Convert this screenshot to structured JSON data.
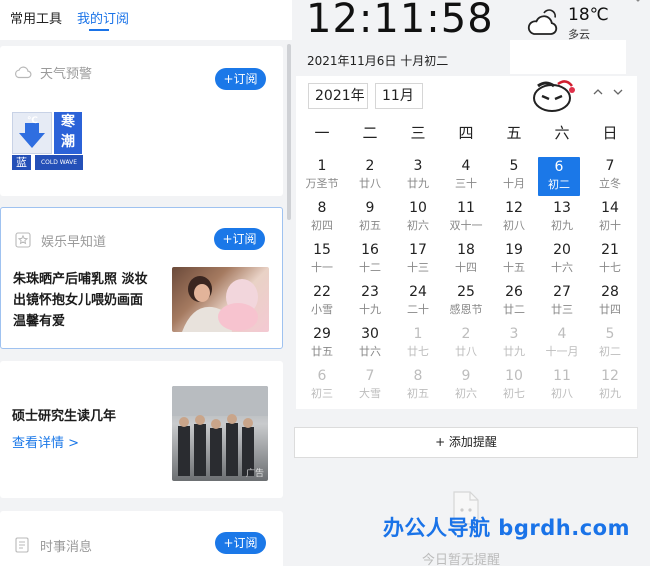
{
  "tabs": {
    "tools": "常用工具",
    "subscriptions": "我的订阅"
  },
  "subscribe_label": "+订阅",
  "cards": {
    "weather": {
      "title": "天气预警",
      "badge_blue_label": "蓝",
      "badge_temp": "℃",
      "badge_cold_top": "寒",
      "badge_cold_bottom": "潮",
      "badge_cold_en": "COLD WAVE"
    },
    "entertainment": {
      "title": "娱乐早知道",
      "headline_line1": "朱珠晒产后哺乳照 淡妆",
      "headline_line2": "出镜怀抱女儿喂奶画面",
      "headline_line3": "温馨有爱"
    },
    "ad": {
      "headline": "硕士研究生读几年",
      "more_link": "查看详情 >",
      "ad_tag": "广告"
    },
    "news": {
      "title": "时事消息"
    }
  },
  "clock": {
    "time": "12:11:58",
    "date": "2021年11月6日  十月初二"
  },
  "weather": {
    "temp": "18℃",
    "desc": "多云",
    "icon": "cloud-sun-icon"
  },
  "calendar": {
    "year": "2021年",
    "month": "11月",
    "weekdays": [
      "一",
      "二",
      "三",
      "四",
      "五",
      "六",
      "日"
    ],
    "days": [
      {
        "d": "1",
        "l": "万圣节"
      },
      {
        "d": "2",
        "l": "廿八"
      },
      {
        "d": "3",
        "l": "廿九"
      },
      {
        "d": "4",
        "l": "三十"
      },
      {
        "d": "5",
        "l": "十月"
      },
      {
        "d": "6",
        "l": "初二",
        "today": true
      },
      {
        "d": "7",
        "l": "立冬"
      },
      {
        "d": "8",
        "l": "初四"
      },
      {
        "d": "9",
        "l": "初五"
      },
      {
        "d": "10",
        "l": "初六"
      },
      {
        "d": "11",
        "l": "双十一"
      },
      {
        "d": "12",
        "l": "初八"
      },
      {
        "d": "13",
        "l": "初九"
      },
      {
        "d": "14",
        "l": "初十"
      },
      {
        "d": "15",
        "l": "十一"
      },
      {
        "d": "16",
        "l": "十二"
      },
      {
        "d": "17",
        "l": "十三"
      },
      {
        "d": "18",
        "l": "十四"
      },
      {
        "d": "19",
        "l": "十五"
      },
      {
        "d": "20",
        "l": "十六"
      },
      {
        "d": "21",
        "l": "十七"
      },
      {
        "d": "22",
        "l": "小雪"
      },
      {
        "d": "23",
        "l": "十九"
      },
      {
        "d": "24",
        "l": "二十"
      },
      {
        "d": "25",
        "l": "感恩节"
      },
      {
        "d": "26",
        "l": "廿二"
      },
      {
        "d": "27",
        "l": "廿三"
      },
      {
        "d": "28",
        "l": "廿四"
      },
      {
        "d": "29",
        "l": "廿五"
      },
      {
        "d": "30",
        "l": "廿六"
      },
      {
        "d": "1",
        "l": "廿七",
        "other": true
      },
      {
        "d": "2",
        "l": "廿八",
        "other": true
      },
      {
        "d": "3",
        "l": "廿九",
        "other": true
      },
      {
        "d": "4",
        "l": "十一月",
        "other": true
      },
      {
        "d": "5",
        "l": "初二",
        "other": true
      },
      {
        "d": "6",
        "l": "初三",
        "other": true
      },
      {
        "d": "7",
        "l": "大雪",
        "other": true
      },
      {
        "d": "8",
        "l": "初五",
        "other": true
      },
      {
        "d": "9",
        "l": "初六",
        "other": true
      },
      {
        "d": "10",
        "l": "初七",
        "other": true
      },
      {
        "d": "11",
        "l": "初八",
        "other": true
      },
      {
        "d": "12",
        "l": "初九",
        "other": true
      }
    ]
  },
  "reminders": {
    "add_label": "+ 添加提醒",
    "empty_text": "今日暂无提醒"
  },
  "watermark": "办公人导航 bgrdh.com",
  "colors": {
    "accent": "#1b78e8",
    "background": "#f2f3f5"
  }
}
